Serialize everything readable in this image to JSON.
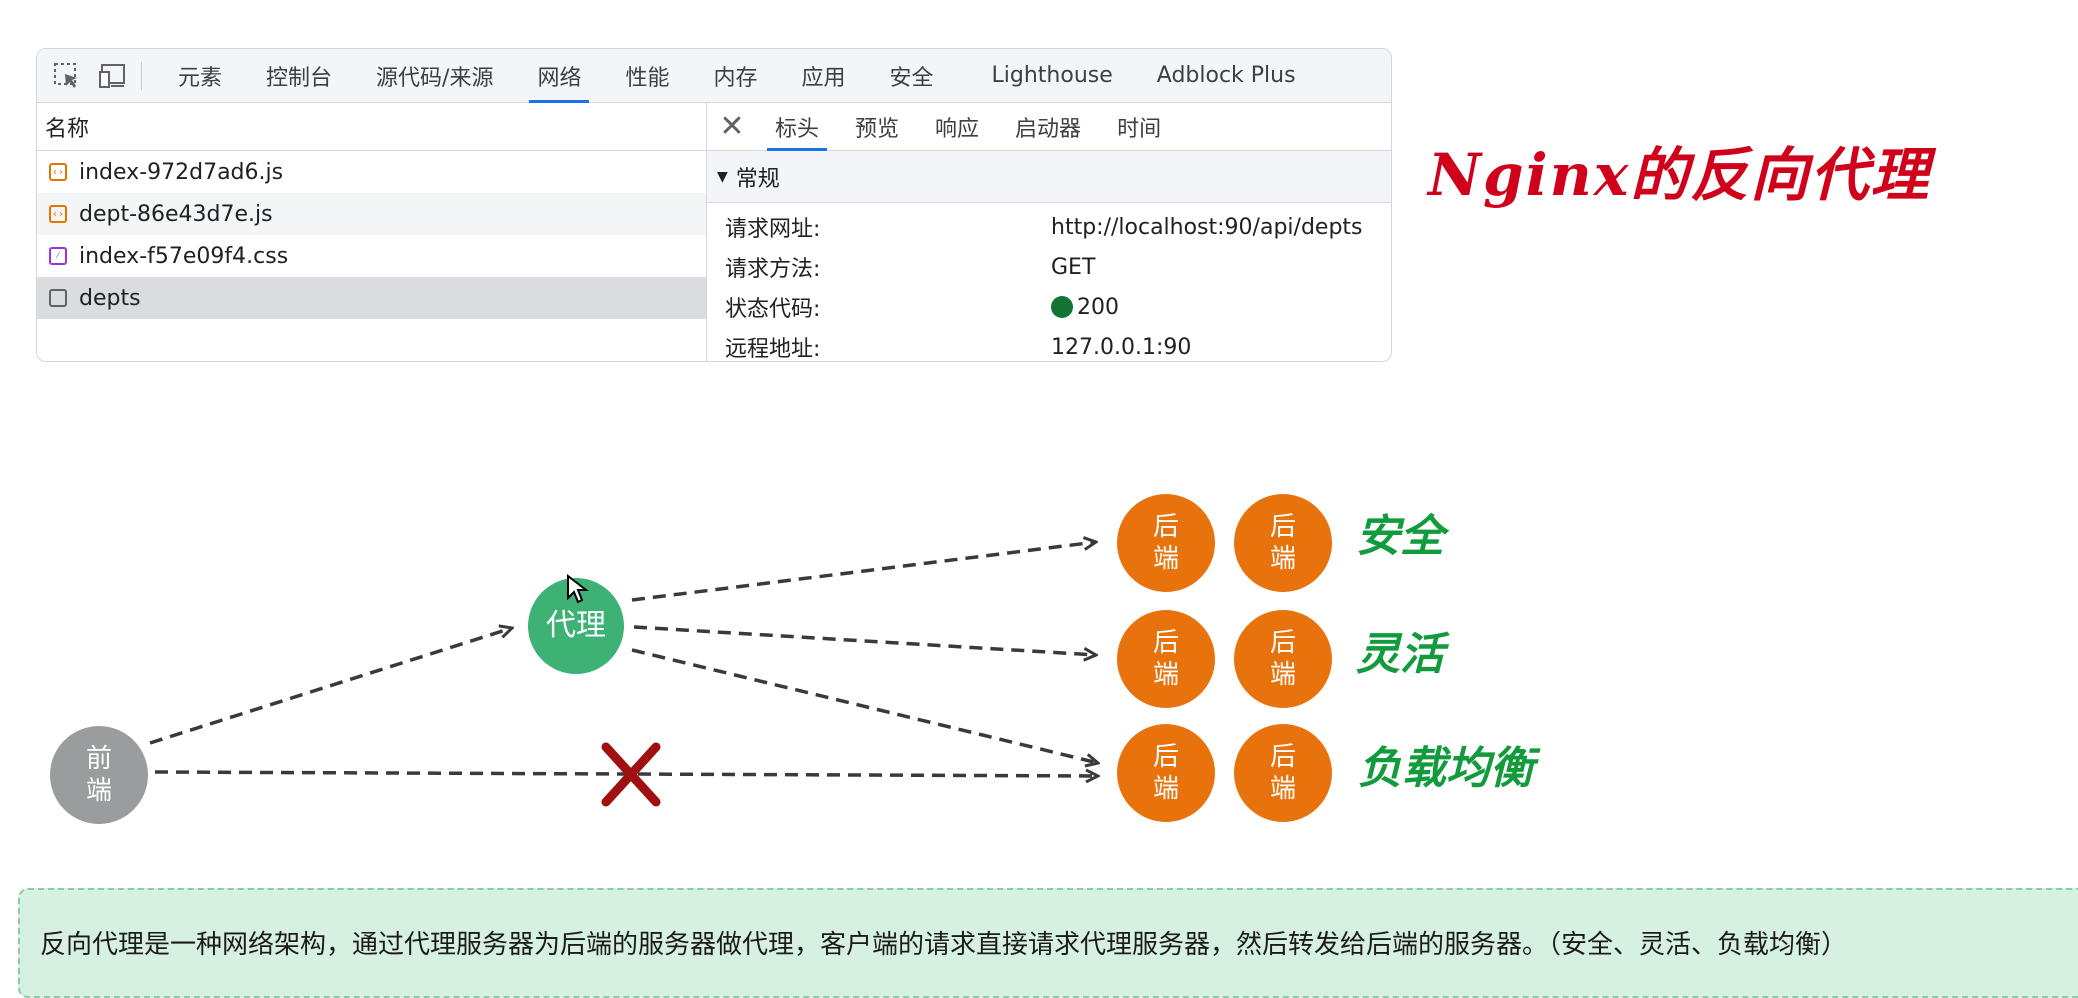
{
  "devtools": {
    "tool_icons": [
      "inspect-element-icon",
      "device-toolbar-icon"
    ],
    "main_tabs": [
      {
        "label": "元素"
      },
      {
        "label": "控制台"
      },
      {
        "label": "源代码/来源"
      },
      {
        "label": "网络",
        "active": true
      },
      {
        "label": "性能"
      },
      {
        "label": "内存"
      },
      {
        "label": "应用"
      },
      {
        "label": "安全"
      },
      {
        "label": "Lighthouse"
      },
      {
        "label": "Adblock Plus"
      }
    ],
    "requests_header": "名称",
    "requests": [
      {
        "name": "index-972d7ad6.js",
        "icon": "script-file-icon"
      },
      {
        "name": "dept-86e43d7e.js",
        "icon": "script-file-icon"
      },
      {
        "name": "index-f57e09f4.css",
        "icon": "stylesheet-file-icon"
      },
      {
        "name": "depts",
        "icon": "fetch-request-icon",
        "selected": true
      }
    ],
    "detail_tabs": [
      {
        "label": "标头",
        "active": true
      },
      {
        "label": "预览"
      },
      {
        "label": "响应"
      },
      {
        "label": "启动器"
      },
      {
        "label": "时间"
      }
    ],
    "section_title": "常规",
    "general": [
      {
        "key": "请求网址:",
        "value": "http://localhost:90/api/depts"
      },
      {
        "key": "请求方法:",
        "value": "GET"
      },
      {
        "key": "状态代码:",
        "value": "200",
        "status_color": "#137333"
      },
      {
        "key": "远程地址:",
        "value": "127.0.0.1:90"
      }
    ]
  },
  "title": "Nginx的反向代理",
  "diagram": {
    "frontend": "前端",
    "proxy": "代理",
    "backend": "后端",
    "labels": [
      "安全",
      "灵活",
      "负载均衡"
    ],
    "colors": {
      "frontend": "#9a9c9e",
      "proxy": "#3db274",
      "backend": "#e8720c",
      "label": "#129b3c",
      "blocked": "#a01010"
    }
  },
  "note": "反向代理是一种网络架构，通过代理服务器为后端的服务器做代理，客户端的请求直接请求代理服务器，然后转发给后端的服务器。（安全、灵活、负载均衡）"
}
